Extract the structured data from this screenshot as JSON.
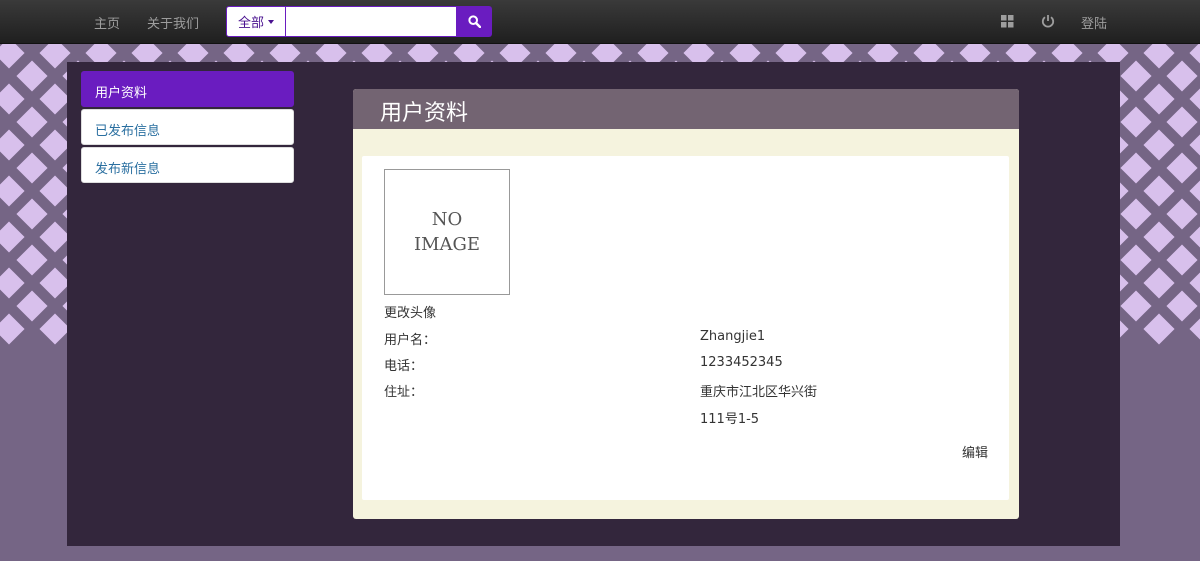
{
  "navbar": {
    "home_label": "主页",
    "about_label": "关于我们",
    "search": {
      "category_label": "全部",
      "query_value": "",
      "placeholder": ""
    },
    "login_label": "登陆"
  },
  "sidebar": {
    "items": [
      {
        "label": "用户资料"
      },
      {
        "label": "已发布信息"
      },
      {
        "label": "发布新信息"
      }
    ]
  },
  "profile": {
    "title": "用户资料",
    "avatar_text_line1": "NO",
    "avatar_text_line2": "IMAGE",
    "change_avatar_label": "更改头像",
    "fields": [
      {
        "label": "用户名：",
        "value": "Zhangjie1"
      },
      {
        "label": "电话：",
        "value": "1233452345"
      },
      {
        "label": "住址：",
        "value": "重庆市江北区华兴街"
      }
    ],
    "address_line2": "111号1-5",
    "edit_label": "编辑"
  },
  "colors": {
    "accent": "#6a1cc0",
    "panel_header": "#736472",
    "container_bg": "#33263c",
    "link": "#2a6fa0"
  }
}
